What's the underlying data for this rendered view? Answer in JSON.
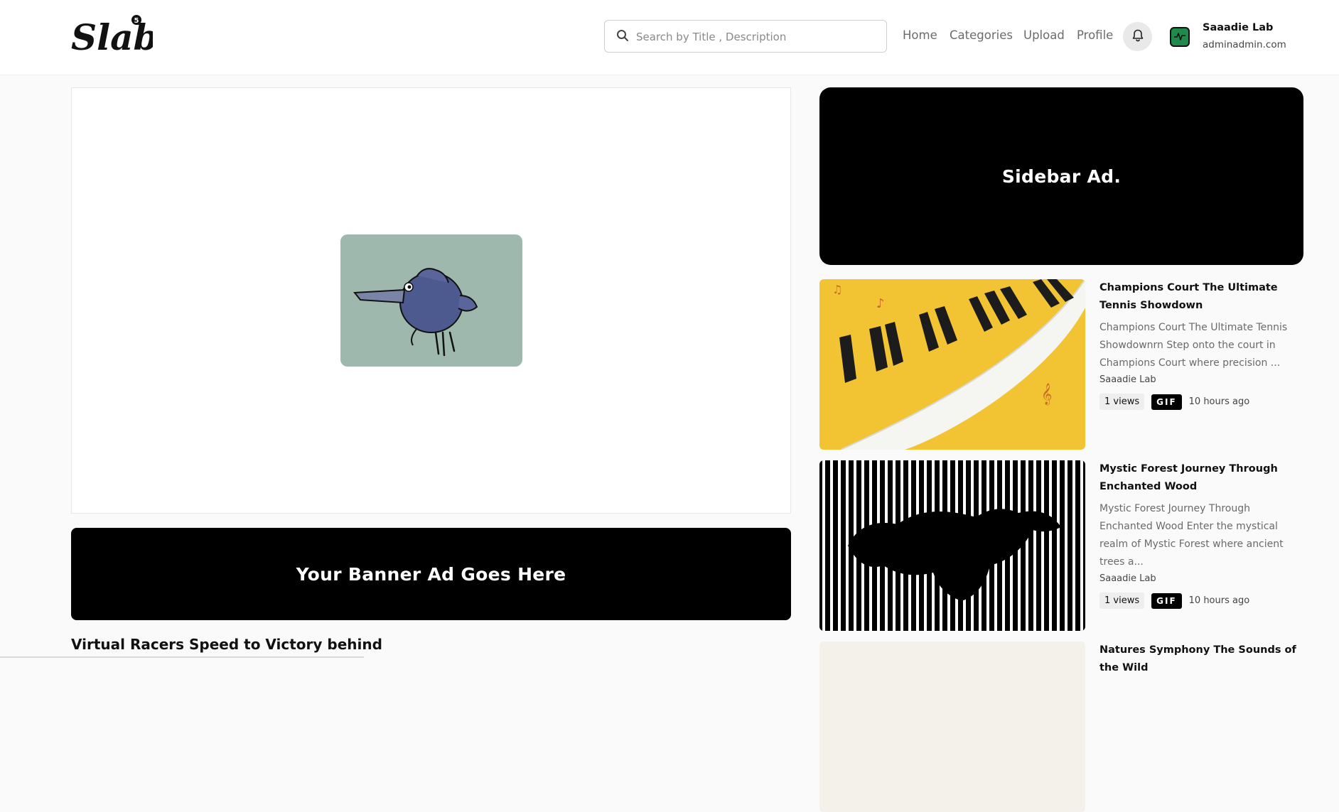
{
  "brand": {
    "logo_text": "Slab",
    "logo_badge": "5"
  },
  "search": {
    "placeholder": "Search by Title , Description",
    "value": ""
  },
  "nav": {
    "home": "Home",
    "categories": "Categories",
    "upload": "Upload",
    "profile": "Profile"
  },
  "user": {
    "name": "Saaadie Lab",
    "email": "adminadmin.com"
  },
  "icons": {
    "search": "search-icon",
    "bell": "bell-icon",
    "avatar": "activity-icon"
  },
  "main": {
    "banner_ad": "Your Banner Ad Goes Here",
    "title": "Virtual Racers Speed to Victory behind"
  },
  "sidebar": {
    "ad": "Sidebar Ad.",
    "items": [
      {
        "title": "Champions Court The Ultimate Tennis Showdown",
        "description": "Champions Court The Ultimate Tennis Showdownrn Step onto the court in Champions Court where precision ...",
        "author": "Saaadie Lab",
        "views": "1 views",
        "type": "GIF",
        "time": "10 hours ago"
      },
      {
        "title": "Mystic Forest Journey Through Enchanted Wood",
        "description": "Mystic Forest Journey Through Enchanted Wood Enter the mystical realm of Mystic Forest where ancient trees a...",
        "author": "Saaadie Lab",
        "views": "1 views",
        "type": "GIF",
        "time": "10 hours ago"
      },
      {
        "title": "Natures Symphony The Sounds of the Wild"
      }
    ]
  },
  "colors": {
    "accent_black": "#000000",
    "gif_bg": "#9eb8ad",
    "avatar_green": "#1f8a4c"
  }
}
